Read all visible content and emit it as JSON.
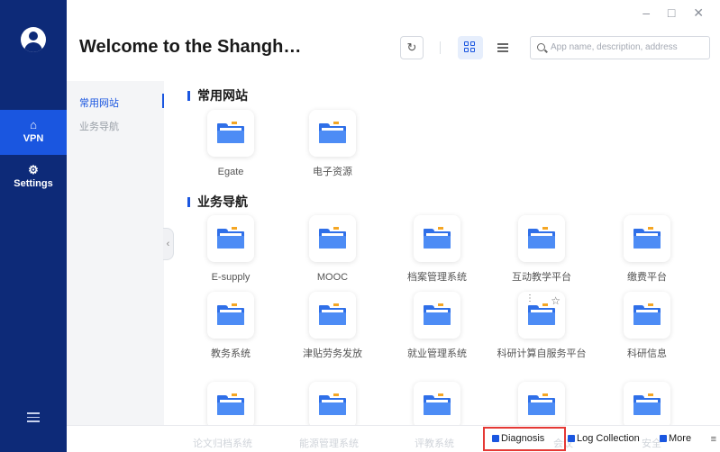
{
  "window": {
    "title": "Welcome to the Shangh…",
    "controls": "– □ ✕"
  },
  "nav": {
    "vpn_label": "VPN",
    "settings_label": "Settings"
  },
  "toolbar": {
    "search_placeholder": "App name, description, address"
  },
  "categories": [
    {
      "label": "常用网站"
    },
    {
      "label": "业务导航"
    }
  ],
  "sections": [
    {
      "title": "常用网站",
      "apps": [
        {
          "label": "Egate"
        },
        {
          "label": "电子资源"
        }
      ]
    },
    {
      "title": "业务导航",
      "apps": [
        {
          "label": "E-supply"
        },
        {
          "label": "MOOC"
        },
        {
          "label": "档案管理系统"
        },
        {
          "label": "互动教学平台"
        },
        {
          "label": "缴费平台"
        },
        {
          "label": "教务系统"
        },
        {
          "label": "津贴劳务发放"
        },
        {
          "label": "就业管理系统"
        },
        {
          "label": "科研计算自服务平台"
        },
        {
          "label": "科研信息"
        }
      ]
    }
  ],
  "bottombar": {
    "diagnosis_label": "Diagnosis",
    "log_label": "Log Collection",
    "more_label": "More",
    "ghost_labels": [
      "论文归档系统",
      "能源管理系统",
      "评教系统",
      "会议",
      "安全"
    ]
  }
}
